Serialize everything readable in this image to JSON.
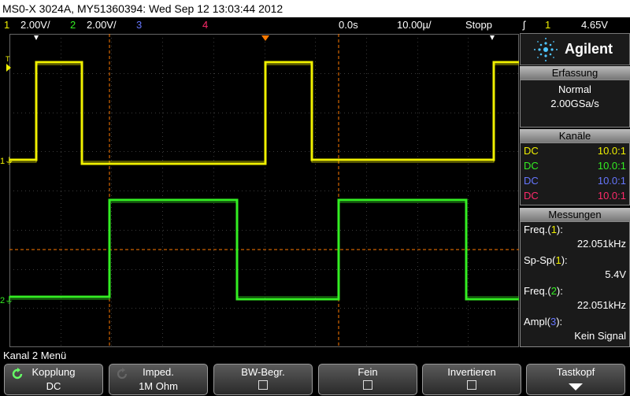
{
  "title": "MS0-X 3024A, MY51360394: Wed Sep 12 13:03:44 2012",
  "status": {
    "ch1_num": "1",
    "ch1_scale": "2.00V/",
    "ch2_num": "2",
    "ch2_scale": "2.00V/",
    "ch3_num": "3",
    "ch4_num": "4",
    "delay": "0.0s",
    "timebase": "10.00µ/",
    "run_state": "Stopp",
    "trigger_icon": "trigger-edge-icon",
    "trig_source": "1",
    "trig_level": "4.65V"
  },
  "colors": {
    "ch1": "#f0f000",
    "ch2": "#33ee22",
    "ch3": "#6677ff",
    "ch4": "#ff2a6a",
    "cursor": "#ff7a00"
  },
  "panel": {
    "brand": "Agilent",
    "acq_header": "Erfassung",
    "acq_mode": "Normal",
    "acq_rate": "2.00GSa/s",
    "channels_header": "Kanäle",
    "channels": [
      {
        "coupling": "DC",
        "probe": "10.0:1"
      },
      {
        "coupling": "DC",
        "probe": "10.0:1"
      },
      {
        "coupling": "DC",
        "probe": "10.0:1"
      },
      {
        "coupling": "DC",
        "probe": "10.0:1"
      }
    ],
    "meas_header": "Messungen",
    "measurements": [
      {
        "name": "Freq.",
        "ch": "1",
        "value": "22.051kHz"
      },
      {
        "name": "Sp-Sp",
        "ch": "1",
        "value": "5.4V"
      },
      {
        "name": "Freq.",
        "ch": "2",
        "value": "22.051kHz"
      },
      {
        "name": "Ampl",
        "ch": "3",
        "value": "Kein Signal"
      }
    ]
  },
  "menu_title": "Kanal 2 Menü",
  "softkeys": [
    {
      "label": "Kopplung",
      "value": "DC"
    },
    {
      "label": "Imped.",
      "value": "1M Ohm"
    },
    {
      "label": "BW-Begr.",
      "value": ""
    },
    {
      "label": "Fein",
      "value": ""
    },
    {
      "label": "Invertieren",
      "value": ""
    },
    {
      "label": "Tastkopf",
      "value": ""
    }
  ]
}
